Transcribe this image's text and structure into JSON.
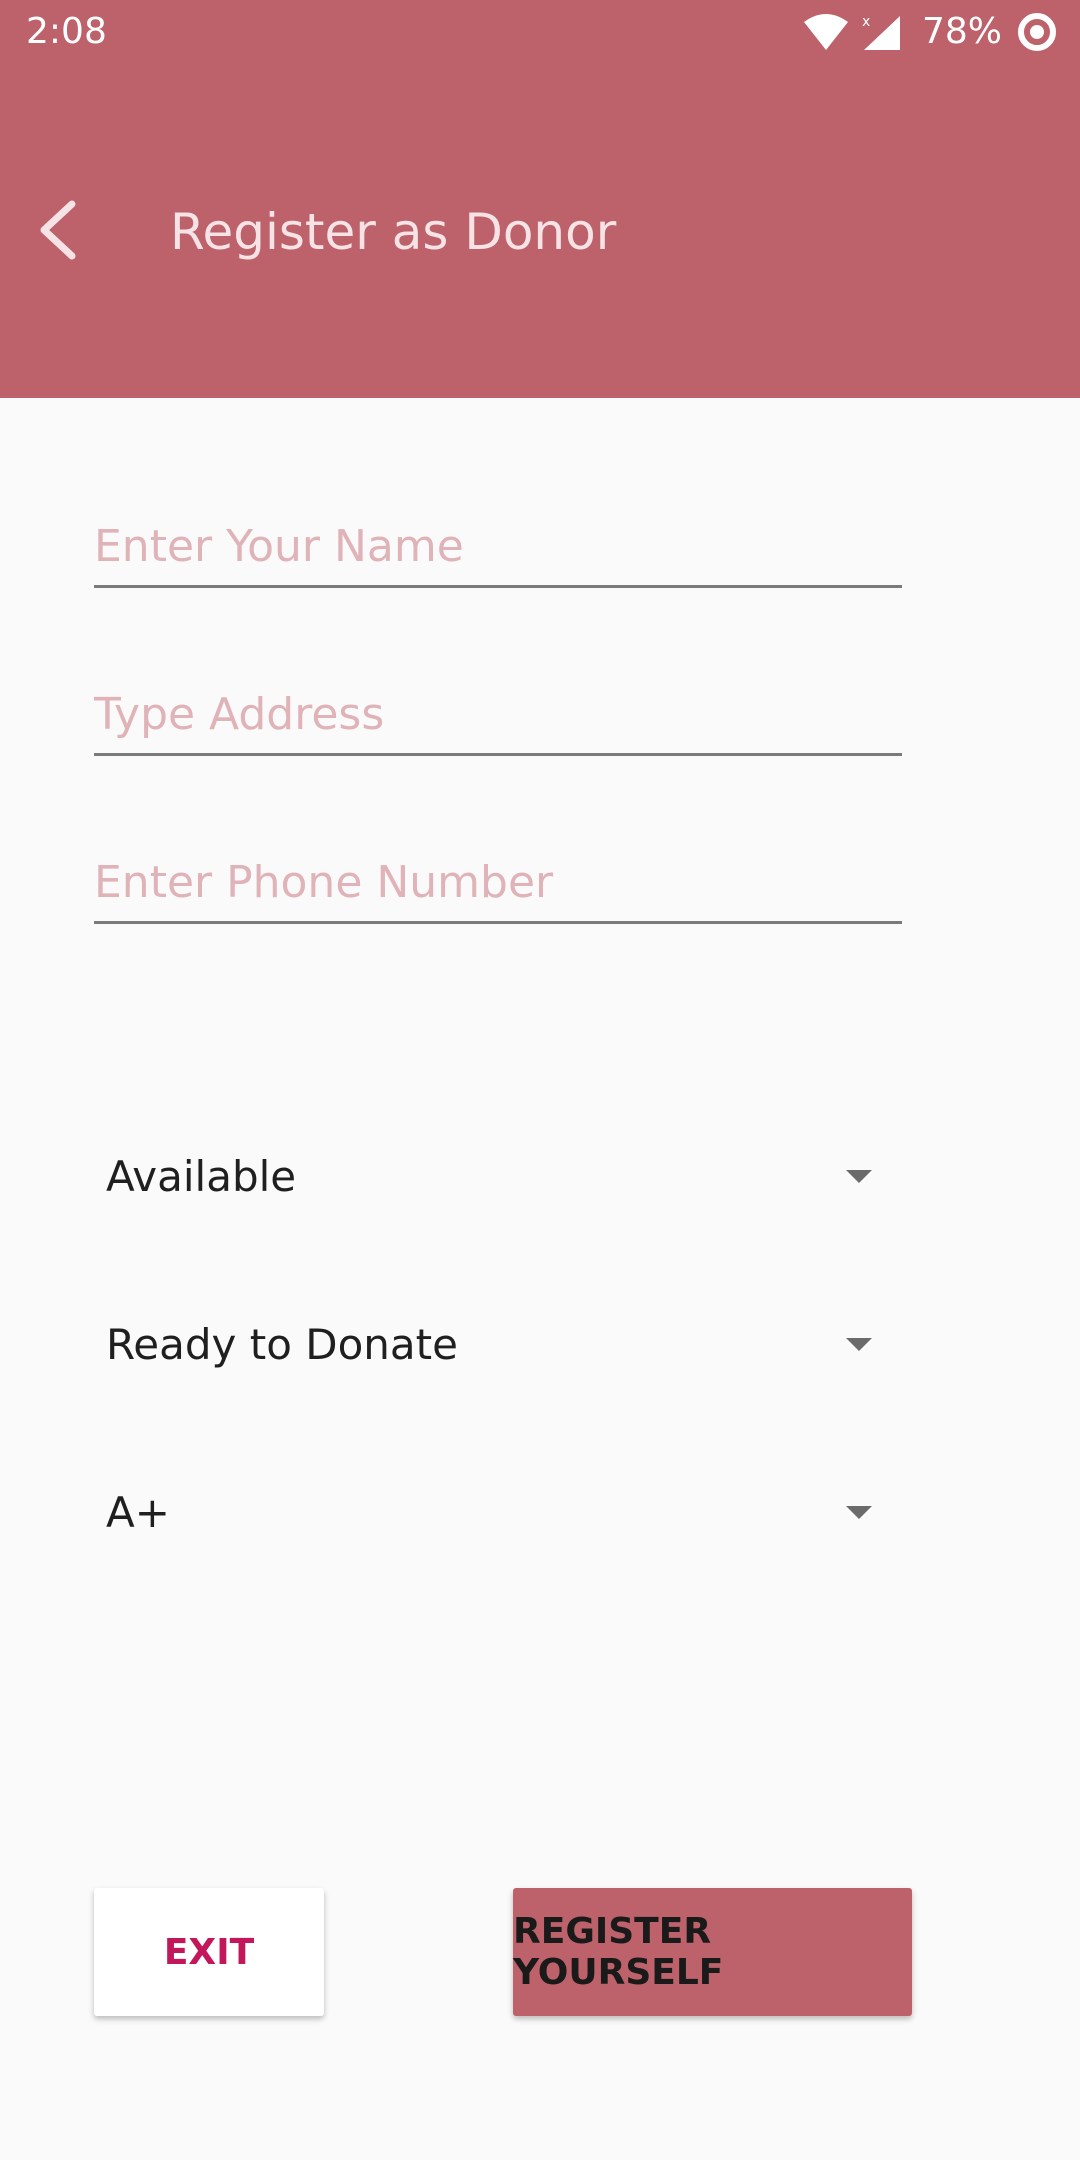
{
  "status_bar": {
    "time": "2:08",
    "battery": "78%",
    "wifi_icon": "wifi-icon",
    "signal_icon": "signal-icon",
    "battery_icon": "battery-icon"
  },
  "app_bar": {
    "back_icon": "back-arrow-icon",
    "title": "Register as Donor"
  },
  "form": {
    "name_placeholder": "Enter Your Name",
    "address_placeholder": "Type Address",
    "phone_placeholder": "Enter Phone Number",
    "name_value": "",
    "address_value": "",
    "phone_value": ""
  },
  "spinners": {
    "availability": "Available",
    "donation_status": "Ready to Donate",
    "blood_group": "A+",
    "dropdown_icon": "dropdown-arrow-icon"
  },
  "buttons": {
    "exit": "EXIT",
    "register": "REGISTER YOURSELF"
  },
  "colors": {
    "primary": "#bd616a",
    "accent": "#c2185b",
    "placeholder": "#e0b3b8",
    "background": "#fafafa"
  }
}
